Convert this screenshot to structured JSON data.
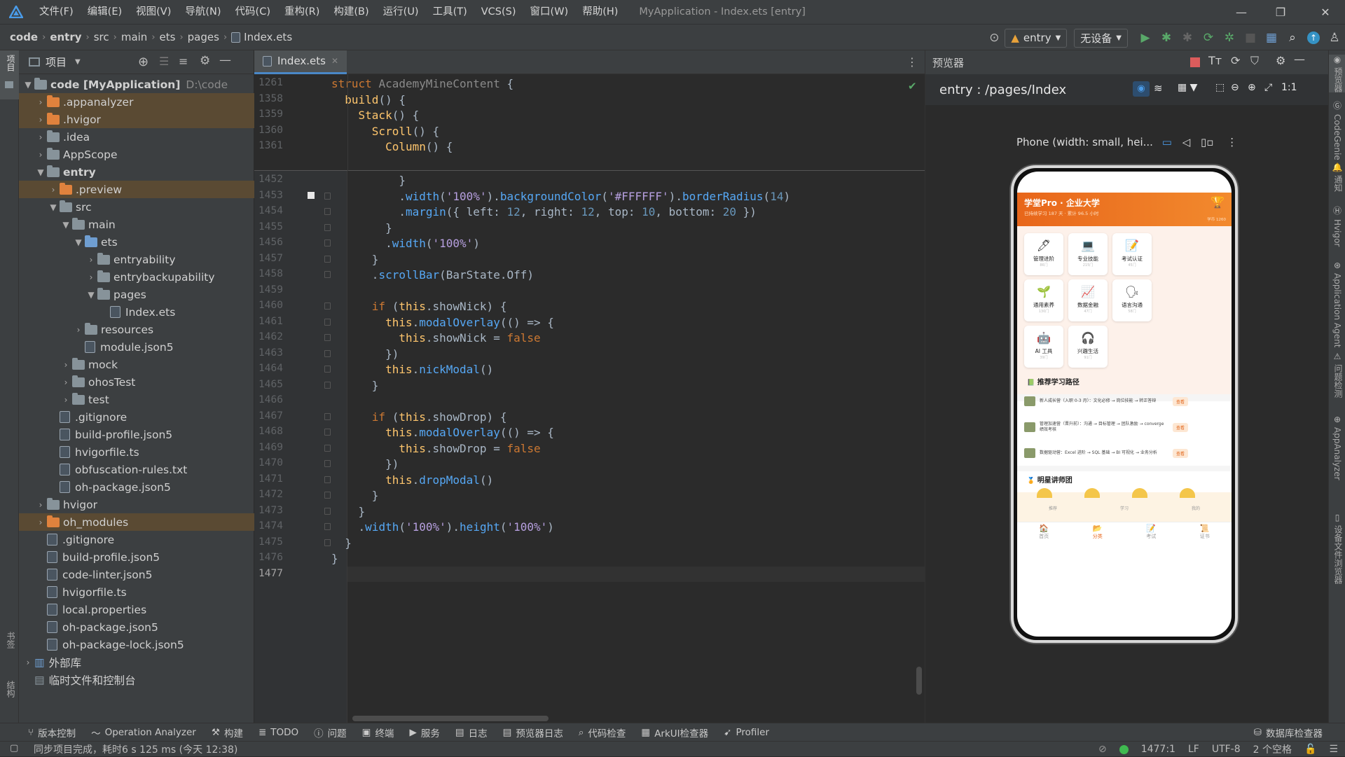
{
  "menu": {
    "items": [
      "文件(F)",
      "编辑(E)",
      "视图(V)",
      "导航(N)",
      "代码(C)",
      "重构(R)",
      "构建(B)",
      "运行(U)",
      "工具(T)",
      "VCS(S)",
      "窗口(W)",
      "帮助(H)"
    ],
    "window_title": "MyApplication - Index.ets [entry]"
  },
  "breadcrumb": [
    "code",
    "entry",
    "src",
    "main",
    "ets",
    "pages",
    "Index.ets"
  ],
  "toolbar": {
    "module_combo": "entry",
    "device_combo": "无设备"
  },
  "left_strip": {
    "project": "项目",
    "bookmarks": "书签",
    "structure": "结构"
  },
  "project": {
    "header": "项目",
    "tree": [
      {
        "depth": 0,
        "arrow": "▼",
        "icon": "folder-gray",
        "label": "code [MyApplication]",
        "extra": "D:\\code",
        "bold": true
      },
      {
        "depth": 1,
        "arrow": "›",
        "icon": "folder-orange",
        "label": ".appanalyzer",
        "hl": true
      },
      {
        "depth": 1,
        "arrow": "›",
        "icon": "folder-orange",
        "label": ".hvigor",
        "hl": true
      },
      {
        "depth": 1,
        "arrow": "›",
        "icon": "folder-gray",
        "label": ".idea"
      },
      {
        "depth": 1,
        "arrow": "›",
        "icon": "folder-gray",
        "label": "AppScope"
      },
      {
        "depth": 1,
        "arrow": "▼",
        "icon": "folder-gray",
        "label": "entry",
        "bold": true
      },
      {
        "depth": 2,
        "arrow": "›",
        "icon": "folder-orange",
        "label": ".preview",
        "hl": true
      },
      {
        "depth": 2,
        "arrow": "▼",
        "icon": "folder-gray",
        "label": "src"
      },
      {
        "depth": 3,
        "arrow": "▼",
        "icon": "folder-gray",
        "label": "main"
      },
      {
        "depth": 4,
        "arrow": "▼",
        "icon": "folder-blue",
        "label": "ets"
      },
      {
        "depth": 5,
        "arrow": "›",
        "icon": "folder-gray",
        "label": "entryability"
      },
      {
        "depth": 5,
        "arrow": "›",
        "icon": "folder-gray",
        "label": "entrybackupability"
      },
      {
        "depth": 5,
        "arrow": "▼",
        "icon": "folder-gray",
        "label": "pages"
      },
      {
        "depth": 6,
        "arrow": "",
        "icon": "file",
        "label": "Index.ets"
      },
      {
        "depth": 4,
        "arrow": "›",
        "icon": "folder-gray",
        "label": "resources"
      },
      {
        "depth": 4,
        "arrow": "",
        "icon": "file",
        "label": "module.json5"
      },
      {
        "depth": 3,
        "arrow": "›",
        "icon": "folder-gray",
        "label": "mock"
      },
      {
        "depth": 3,
        "arrow": "›",
        "icon": "folder-gray",
        "label": "ohosTest"
      },
      {
        "depth": 3,
        "arrow": "›",
        "icon": "folder-gray",
        "label": "test"
      },
      {
        "depth": 2,
        "arrow": "",
        "icon": "file",
        "label": ".gitignore"
      },
      {
        "depth": 2,
        "arrow": "",
        "icon": "file",
        "label": "build-profile.json5"
      },
      {
        "depth": 2,
        "arrow": "",
        "icon": "file",
        "label": "hvigorfile.ts"
      },
      {
        "depth": 2,
        "arrow": "",
        "icon": "file",
        "label": "obfuscation-rules.txt"
      },
      {
        "depth": 2,
        "arrow": "",
        "icon": "file",
        "label": "oh-package.json5"
      },
      {
        "depth": 1,
        "arrow": "›",
        "icon": "folder-gray",
        "label": "hvigor"
      },
      {
        "depth": 1,
        "arrow": "›",
        "icon": "folder-orange",
        "label": "oh_modules",
        "hl": true
      },
      {
        "depth": 1,
        "arrow": "",
        "icon": "file",
        "label": ".gitignore"
      },
      {
        "depth": 1,
        "arrow": "",
        "icon": "file",
        "label": "build-profile.json5"
      },
      {
        "depth": 1,
        "arrow": "",
        "icon": "file",
        "label": "code-linter.json5"
      },
      {
        "depth": 1,
        "arrow": "",
        "icon": "file",
        "label": "hvigorfile.ts"
      },
      {
        "depth": 1,
        "arrow": "",
        "icon": "file",
        "label": "local.properties"
      },
      {
        "depth": 1,
        "arrow": "",
        "icon": "file",
        "label": "oh-package.json5"
      },
      {
        "depth": 1,
        "arrow": "",
        "icon": "file",
        "label": "oh-package-lock.json5"
      },
      {
        "depth": 0,
        "arrow": "›",
        "icon": "lib",
        "label": "外部库"
      },
      {
        "depth": 0,
        "arrow": "",
        "icon": "scratch",
        "label": "临时文件和控制台"
      }
    ]
  },
  "editor": {
    "tab": "Index.ets",
    "sticky_lines": [
      {
        "n": "1261",
        "html": "<span class='kw'>struct</span> <span class='tr'>AcademyMineContent</span> {"
      },
      {
        "n": "1358",
        "html": "  <span class='fn'>build</span>() {"
      },
      {
        "n": "1359",
        "html": "    <span class='fn'>Stack</span>() {"
      },
      {
        "n": "1360",
        "html": "      <span class='fn'>Scroll</span>() {"
      },
      {
        "n": "1361",
        "html": "        <span class='fn'>Column</span>() {"
      }
    ],
    "lines": [
      {
        "n": "1452",
        "html": "          }"
      },
      {
        "n": "1453",
        "html": "          .<span class='mth'>width</span>(<span class='str'>'100%'</span>).<span class='mth'>backgroundColor</span>(<span class='str'>'#FFFFFF'</span>).<span class='mth'>borderRadius</span>(<span class='num'>14</span>)"
      },
      {
        "n": "1454",
        "html": "          .<span class='mth'>margin</span>({ left: <span class='num'>12</span>, right: <span class='num'>12</span>, top: <span class='num'>10</span>, bottom: <span class='num'>20</span> })"
      },
      {
        "n": "1455",
        "html": "        }"
      },
      {
        "n": "1456",
        "html": "        .<span class='mth'>width</span>(<span class='str'>'100%'</span>)"
      },
      {
        "n": "1457",
        "html": "      }"
      },
      {
        "n": "1458",
        "html": "      .<span class='mth'>scrollBar</span>(BarState.Off)"
      },
      {
        "n": "1459",
        "html": ""
      },
      {
        "n": "1460",
        "html": "      <span class='kw'>if</span> (<span class='fn'>this</span>.showNick) {"
      },
      {
        "n": "1461",
        "html": "        <span class='fn'>this</span>.<span class='mth'>modalOverlay</span>(() => {"
      },
      {
        "n": "1462",
        "html": "          <span class='fn'>this</span>.showNick = <span class='kw'>false</span>"
      },
      {
        "n": "1463",
        "html": "        })"
      },
      {
        "n": "1464",
        "html": "        <span class='fn'>this</span>.<span class='mth'>nickModal</span>()"
      },
      {
        "n": "1465",
        "html": "      }"
      },
      {
        "n": "1466",
        "html": ""
      },
      {
        "n": "1467",
        "html": "      <span class='kw'>if</span> (<span class='fn'>this</span>.showDrop) {"
      },
      {
        "n": "1468",
        "html": "        <span class='fn'>this</span>.<span class='mth'>modalOverlay</span>(() => {"
      },
      {
        "n": "1469",
        "html": "          <span class='fn'>this</span>.showDrop = <span class='kw'>false</span>"
      },
      {
        "n": "1470",
        "html": "        })"
      },
      {
        "n": "1471",
        "html": "        <span class='fn'>this</span>.<span class='mth'>dropModal</span>()"
      },
      {
        "n": "1472",
        "html": "      }"
      },
      {
        "n": "1473",
        "html": "    }"
      },
      {
        "n": "1474",
        "html": "    .<span class='mth'>width</span>(<span class='str'>'100%'</span>).<span class='mth'>height</span>(<span class='str'>'100%'</span>)"
      },
      {
        "n": "1475",
        "html": "  }"
      },
      {
        "n": "1476",
        "html": "}"
      },
      {
        "n": "1477",
        "html": ""
      }
    ]
  },
  "preview": {
    "title": "预览器",
    "path": "entry : /pages/Index",
    "device_label": "Phone (width: small, hei...",
    "app": {
      "header_title": "学堂Pro · 企业大学",
      "header_sub": "已持续学习 187 天 · 累计 96.5 小时",
      "header_badge": "学币 1260",
      "grid": [
        {
          "icon": "🖊",
          "label": "管理进阶",
          "sub": "86门"
        },
        {
          "icon": "💻",
          "label": "专业技能",
          "sub": "215门"
        },
        {
          "icon": "📝",
          "label": "考试认证",
          "sub": "45门"
        },
        {
          "icon": "🌱",
          "label": "通用素养",
          "sub": "130门"
        },
        {
          "icon": "📈",
          "label": "数据金融",
          "sub": "47门"
        },
        {
          "icon": "🗣",
          "label": "语言沟通",
          "sub": "58门"
        },
        {
          "icon": "🤖",
          "label": "AI 工具",
          "sub": "39门"
        },
        {
          "icon": "🎧",
          "label": "兴趣生活",
          "sub": "91门"
        }
      ],
      "section_paths": "推荐学习路径",
      "paths": [
        {
          "text": "新人成长营（入职 0-3 月）：文化必修 → 岗位技能 → 转正答辩",
          "btn": "查看"
        },
        {
          "text": "管理加速营（晋升前）：沟通 → 目标管理 → 团队激励 → converge 绩效考核",
          "btn": "查看"
        },
        {
          "text": "数据驱动营：Excel 进阶 → SQL 基础 → BI 可视化 → 业务分析",
          "btn": "查看"
        }
      ],
      "section_teachers": "明星讲师团",
      "tabbar": [
        "首页",
        "分类",
        "考试",
        "证书"
      ],
      "floatbar": [
        "推荐",
        "学习",
        "我的"
      ]
    }
  },
  "right_strip": [
    "预览器",
    "CodeGenie",
    "通知",
    "Hvigor",
    "Application Agent",
    "问题检测",
    "AppAnalyzer",
    "设备文件浏览器"
  ],
  "bottom_tools": [
    "版本控制",
    "Operation Analyzer",
    "构建",
    "TODO",
    "问题",
    "终端",
    "服务",
    "日志",
    "预览器日志",
    "代码检查",
    "ArkUI检查器",
    "Profiler"
  ],
  "bottom_right_tool": "数据库检查器",
  "status": {
    "message": "同步项目完成，耗时6 s 125 ms (今天 12:38)",
    "position": "1477:1",
    "line_sep": "LF",
    "encoding": "UTF-8",
    "indent": "2 个空格"
  }
}
